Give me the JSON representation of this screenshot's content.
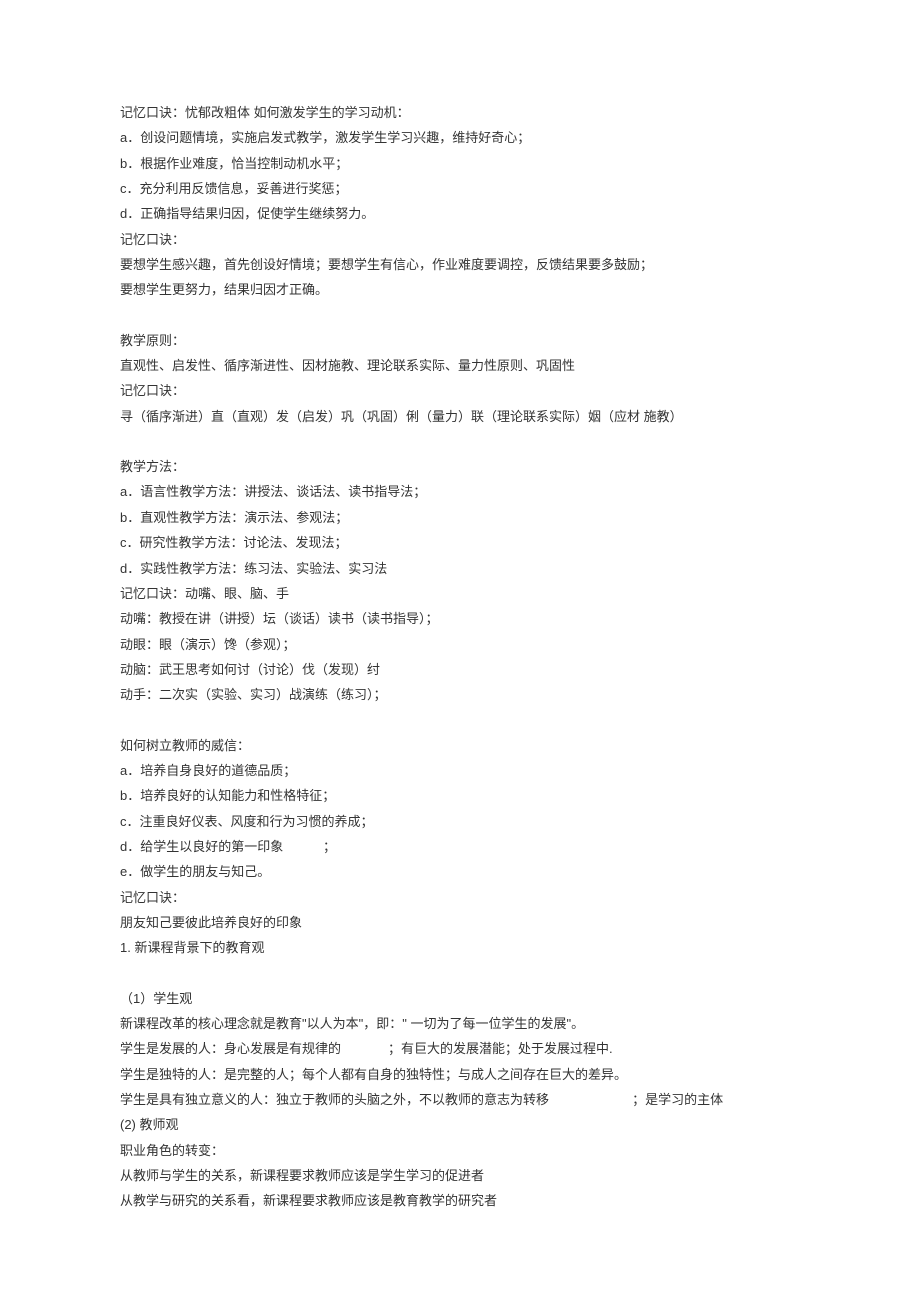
{
  "lines": [
    "记忆口诀：忧郁改粗体 如何激发学生的学习动机：",
    "a．创设问题情境，实施启发式教学，激发学生学习兴趣，维持好奇心；",
    "b．根据作业难度，恰当控制动机水平；",
    "c．充分利用反馈信息，妥善进行奖惩；",
    "d．正确指导结果归因，促使学生继续努力。",
    "记忆口诀：",
    "要想学生感兴趣，首先创设好情境；要想学生有信心，作业难度要调控，反馈结果要多鼓励；",
    "要想学生更努力，结果归因才正确。",
    "",
    "教学原则：",
    "直观性、启发性、循序渐进性、因材施教、理论联系实际、量力性原则、巩固性",
    "记忆口诀：",
    "寻（循序渐进）直（直观）发（启发）巩（巩固）俐（量力）联（理论联系实际）姻（应材 施教）",
    "",
    "教学方法：",
    "a．语言性教学方法：讲授法、谈话法、读书指导法；",
    "b．直观性教学方法：演示法、参观法；",
    "c．研究性教学方法：讨论法、发现法；",
    "d．实践性教学方法：练习法、实验法、实习法",
    "记忆口诀：动嘴、眼、脑、手",
    "动嘴：教授在讲（讲授）坛（谈话）读书（读书指导）；",
    "动眼：眼（演示）馋（参观）；",
    "动脑：武王思考如何讨（讨论）伐（发现）纣",
    "动手：二次实（实验、实习）战演练（练习）；",
    "",
    "如何树立教师的威信：",
    "a．培养自身良好的道德品质；",
    "b．培养良好的认知能力和性格特征；",
    "c．注重良好仪表、风度和行为习惯的养成；",
    "d．给学生以良好的第一印象           ；",
    "e．做学生的朋友与知己。",
    "记忆口诀：",
    "朋友知己要彼此培养良好的印象",
    "1. 新课程背景下的教育观",
    "",
    "（1）学生观",
    "新课程改革的核心理念就是教育\"以人为本\"，即：\" 一切为了每一位学生的发展\"。",
    "学生是发展的人：身心发展是有规律的             ；有巨大的发展潜能；处于发展过程中.",
    "学生是独特的人：是完整的人；每个人都有自身的独特性；与成人之间存在巨大的差异。",
    "学生是具有独立意义的人：独立于教师的头脑之外，不以教师的意志为转移                       ；是学习的主体",
    "(2) 教师观",
    "职业角色的转变：",
    "从教师与学生的关系，新课程要求教师应该是学生学习的促进者",
    "从教学与研究的关系看，新课程要求教师应该是教育教学的研究者"
  ]
}
